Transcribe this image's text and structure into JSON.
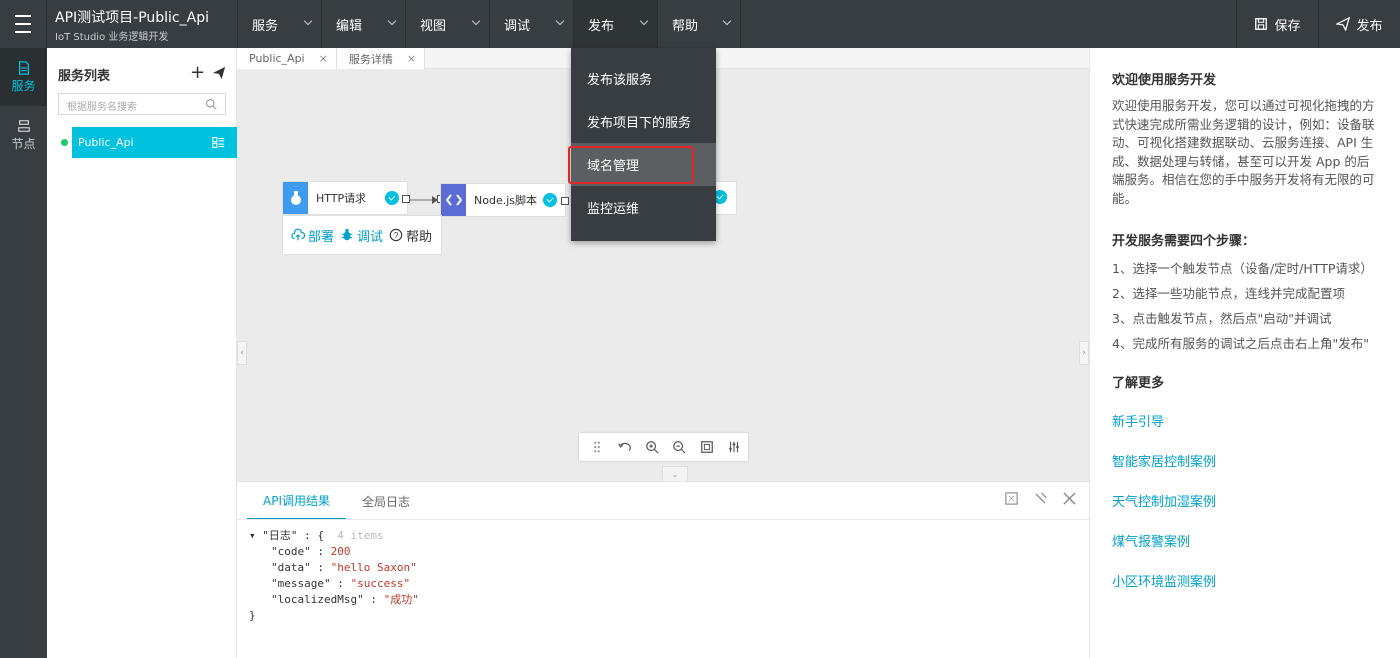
{
  "app": {
    "title": "API测试项目-Public_Api",
    "subtitle": "IoT Studio 业务逻辑开发"
  },
  "menu": {
    "items": [
      {
        "label": "服务"
      },
      {
        "label": "编辑"
      },
      {
        "label": "视图"
      },
      {
        "label": "调试"
      },
      {
        "label": "发布"
      },
      {
        "label": "帮助"
      }
    ],
    "active": "发布"
  },
  "actions": {
    "save_label": "保存",
    "publish_label": "发布"
  },
  "rail": {
    "items": [
      {
        "label": "服务",
        "icon": "document-icon",
        "active": true
      },
      {
        "label": "节点",
        "icon": "node-icon",
        "active": false
      }
    ]
  },
  "service_panel": {
    "title": "服务列表",
    "search_placeholder": "根据服务名搜索",
    "items": [
      {
        "label": "Public_Api",
        "status_color": "#1ec96b"
      }
    ]
  },
  "tabs": [
    {
      "label": "Public_Api",
      "close": "×"
    },
    {
      "label": "服务详情",
      "close": "×"
    }
  ],
  "canvas": {
    "nodes": [
      {
        "label": "HTTP请求",
        "icon": "http-request-icon"
      },
      {
        "label": "Node.js脚本",
        "icon": "code-icon"
      }
    ],
    "node_actions": {
      "deploy": "部署",
      "debug": "调试",
      "help": "帮助"
    }
  },
  "bottom_panel": {
    "tabs": [
      {
        "label": "API调用结果",
        "active": true
      },
      {
        "label": "全局日志",
        "active": false
      }
    ],
    "json": {
      "root_key": "\"日志\"",
      "count": "4 items",
      "lines": [
        {
          "key": "\"code\"",
          "value": "200"
        },
        {
          "key": "\"data\"",
          "value": "\"hello Saxon\""
        },
        {
          "key": "\"message\"",
          "value": "\"success\""
        },
        {
          "key": "\"localizedMsg\"",
          "value": "\"成功\""
        }
      ]
    }
  },
  "dropdown": {
    "items": [
      {
        "label": "发布该服务"
      },
      {
        "label": "发布项目下的服务"
      },
      {
        "label": "域名管理",
        "highlighted": true
      },
      {
        "label": "监控运维"
      }
    ]
  },
  "help": {
    "welcome_title": "欢迎使用服务开发",
    "welcome_text": "欢迎使用服务开发，您可以通过可视化拖拽的方式快速完成所需业务逻辑的设计，例如：设备联动、可视化搭建数据联动、云服务连接、API 生成、数据处理与转储，甚至可以开发 App 的后端服务。相信在您的手中服务开发将有无限的可能。",
    "steps_title": "开发服务需要四个步骤：",
    "steps": [
      "1、选择一个触发节点（设备/定时/HTTP请求）",
      "2、选择一些功能节点，连线并完成配置项",
      "3、点击触发节点，然后点\"启动\"并调试",
      "4、完成所有服务的调试之后点击右上角\"发布\""
    ],
    "more_title": "了解更多",
    "links": [
      "新手引导",
      "智能家居控制案例",
      "天气控制加湿案例",
      "煤气报警案例",
      "小区环境监测案例"
    ]
  },
  "colors": {
    "topbar": "#373d41",
    "accent": "#00c1de",
    "link": "#00a2ca",
    "highlight_border": "#e0282b"
  }
}
